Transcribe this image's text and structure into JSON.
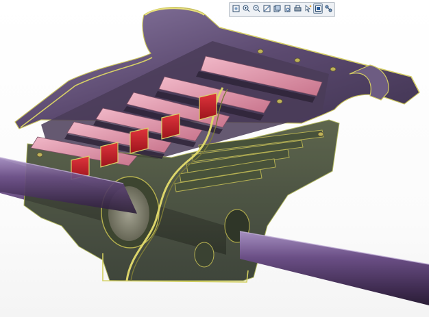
{
  "viewer": {
    "background_color": "#ffffff",
    "accent_color": "#2f5f9a",
    "model_colors": {
      "housing": "#5e6a3c",
      "frame": "#6c5a80",
      "slots": "#cc1f2a",
      "pads": "#d57e96",
      "rod": "#5b3f70"
    }
  },
  "toolbar": {
    "buttons": [
      {
        "name": "zoom-fit-icon"
      },
      {
        "name": "zoom-in-icon"
      },
      {
        "name": "zoom-out-icon"
      },
      {
        "name": "zoom-window-icon"
      },
      {
        "name": "view-orient-icon"
      },
      {
        "name": "rotate-view-icon"
      },
      {
        "name": "print-icon"
      },
      {
        "name": "select-icon"
      },
      {
        "name": "section-view-icon",
        "active": true
      },
      {
        "name": "settings-icon"
      }
    ]
  }
}
